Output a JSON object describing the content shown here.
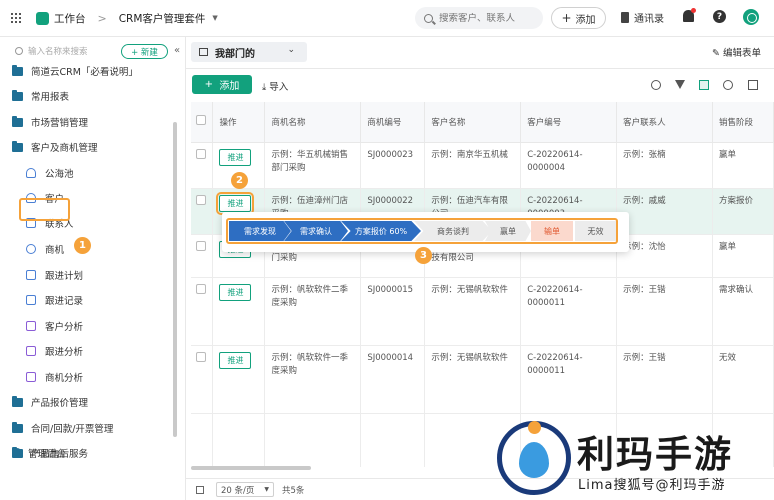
{
  "topbar": {
    "workspace": "工作台",
    "app_name": "CRM客户管理套件",
    "search_placeholder": "搜索客户、联系人",
    "add_label": "添加",
    "contacts_label": "通讯录"
  },
  "sidebar": {
    "search_placeholder": "输入名称来搜索",
    "new_label": "+ 新建",
    "items": [
      {
        "label": "简道云CRM「必看说明」"
      },
      {
        "label": "常用报表"
      },
      {
        "label": "市场营销管理"
      },
      {
        "label": "客户及商机管理"
      },
      {
        "label": "公海池"
      },
      {
        "label": "客户"
      },
      {
        "label": "联系人"
      },
      {
        "label": "商机"
      },
      {
        "label": "跟进计划"
      },
      {
        "label": "跟进记录"
      },
      {
        "label": "客户分析"
      },
      {
        "label": "跟进分析"
      },
      {
        "label": "商机分析"
      },
      {
        "label": "产品报价管理"
      },
      {
        "label": "合同/回款/开票管理"
      },
      {
        "label": "产品售后服务"
      }
    ],
    "admin_label": "管理后台"
  },
  "callouts": {
    "one": "1",
    "two": "2",
    "three": "3"
  },
  "main": {
    "view_name": "我部门的",
    "edit_form_label": "编辑表单",
    "add_label": "添加",
    "import_label": "导入"
  },
  "table": {
    "headers": [
      "操作",
      "商机名称",
      "商机编号",
      "客户名称",
      "客户编号",
      "客户联系人",
      "销售阶段"
    ],
    "advance_label": "推进",
    "rows": [
      {
        "name": "示例：华五机械销售部门采购",
        "code": "SJ0000023",
        "customer": "示例：南京华五机械",
        "cust_code": "C-20220614-0000004",
        "contact": "示例：张楠",
        "stage": "赢单"
      },
      {
        "name": "示例：伍迪漳州门店采购",
        "code": "SJ0000022",
        "customer": "示例：伍迪汽车有限公司",
        "cust_code": "C-20220614-0000003",
        "contact": "示例：戚威",
        "stage": "方案报价"
      },
      {
        "name": "门采购",
        "code": "",
        "customer": "技有限公司",
        "cust_code": "",
        "contact": "示例：沈怡",
        "stage": "赢单"
      },
      {
        "name": "示例：帆软软件二季度采购",
        "code": "SJ0000015",
        "customer": "示例：无锡帆软软件",
        "cust_code": "C-20220614-0000011",
        "contact": "示例：王锴",
        "stage": "需求确认"
      },
      {
        "name": "示例：帆软软件一季度采购",
        "code": "SJ0000014",
        "customer": "示例：无锡帆软软件",
        "cust_code": "C-20220614-0000011",
        "contact": "示例：王锴",
        "stage": "无效"
      }
    ]
  },
  "stages": [
    "需求发现",
    "需求确认",
    "方案报价 60%",
    "商务谈判",
    "赢单",
    "输单",
    "无效"
  ],
  "footer": {
    "page_size": "20 条/页",
    "total": "共5条"
  },
  "watermark": {
    "title": "利玛手游",
    "subtitle": "Lima搜狐号@利玛手游"
  },
  "colors": {
    "accent": "#12a17d",
    "stage_done": "#2e6ec2",
    "callout": "#f5a23a"
  }
}
